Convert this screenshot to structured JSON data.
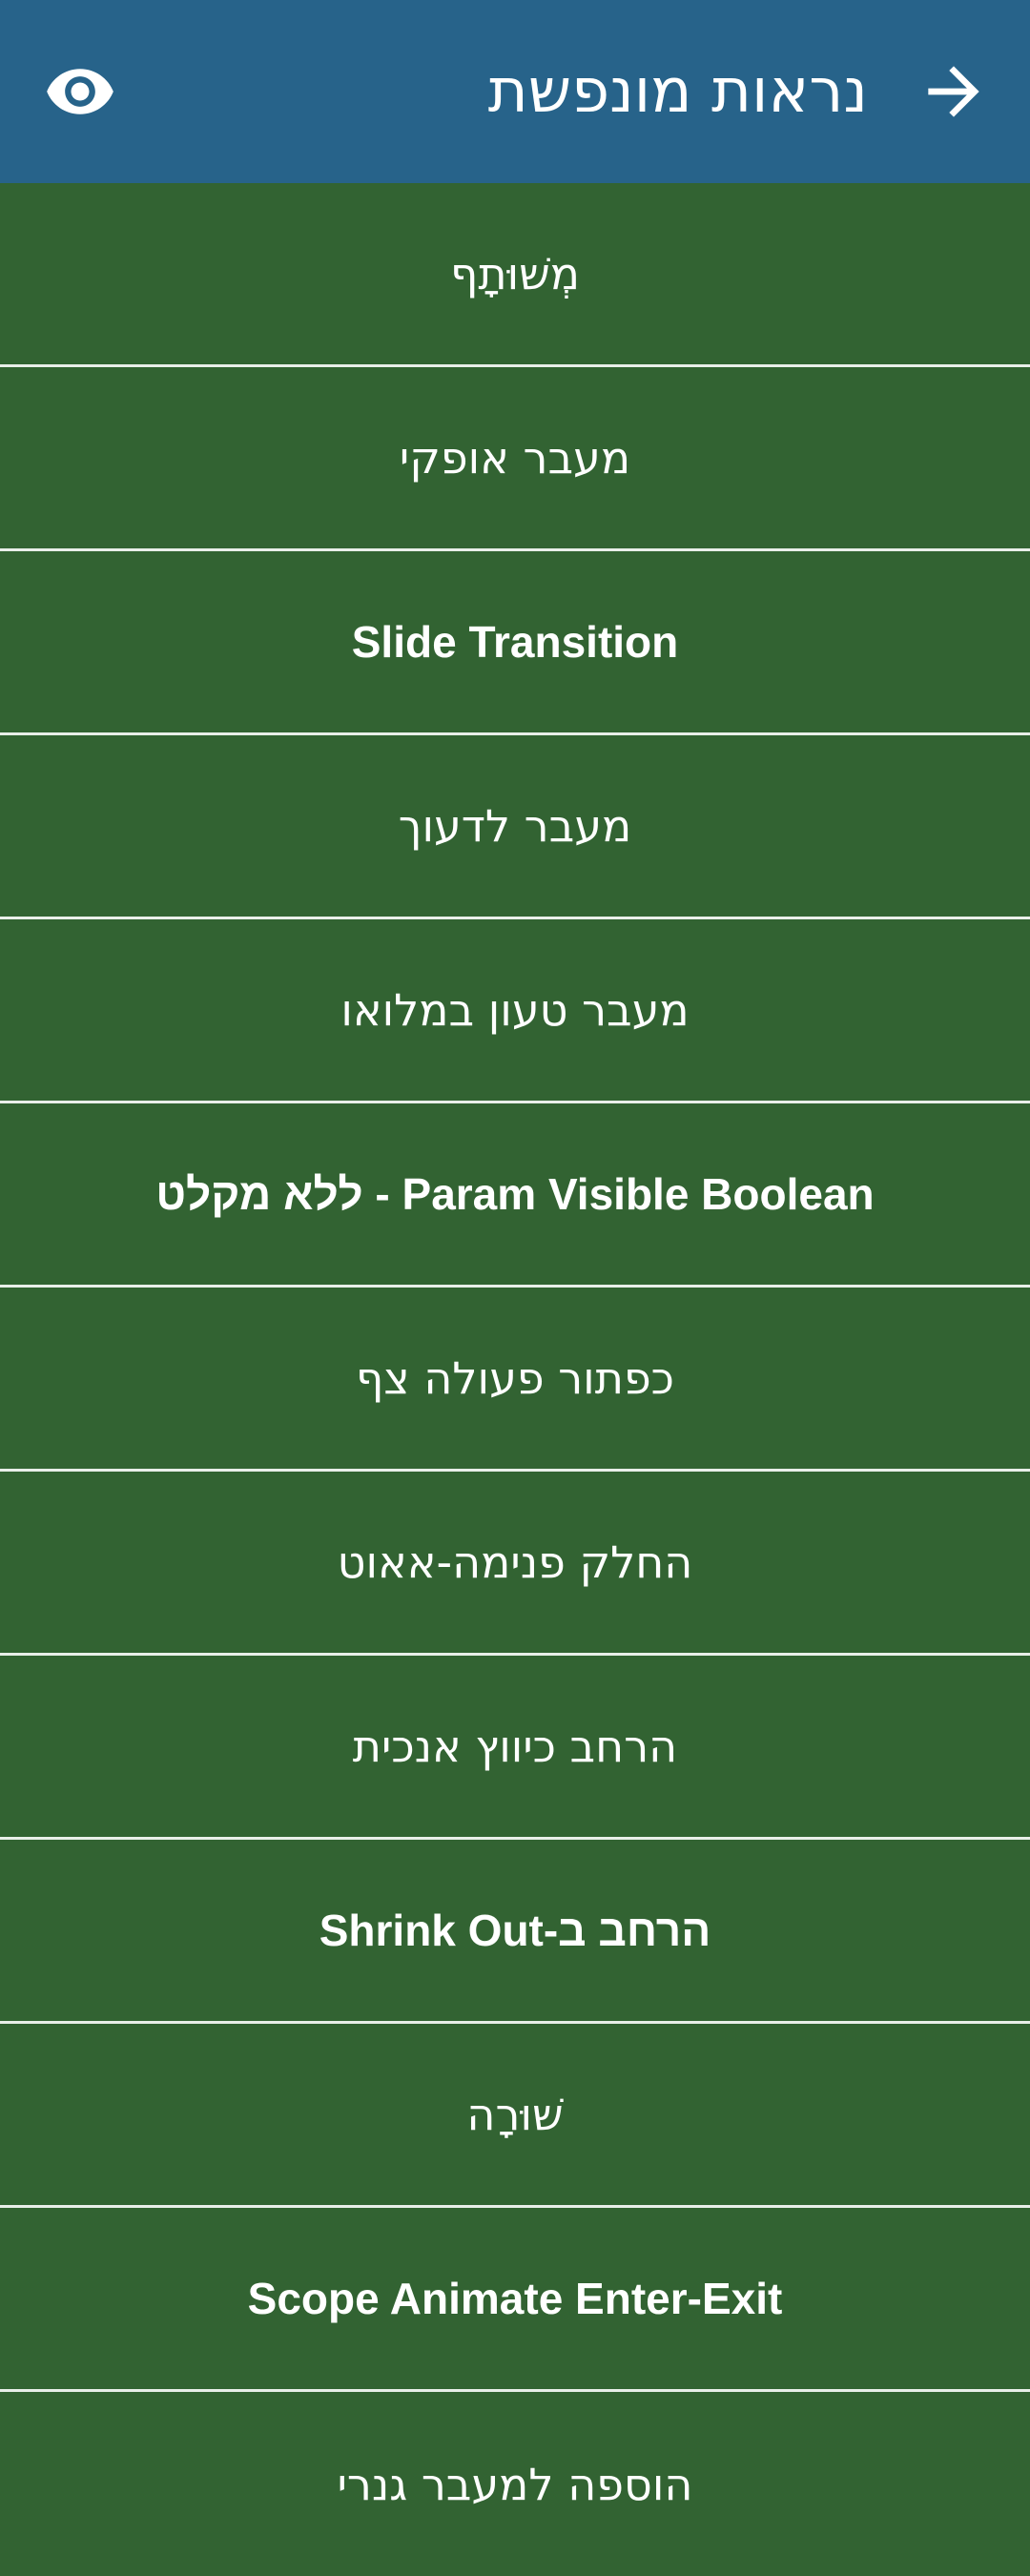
{
  "app_bar": {
    "title": "נראות מונפשת",
    "back_icon": "arrow-right-icon",
    "action_icon": "eye-icon"
  },
  "colors": {
    "app_bar": "#27638a",
    "list_background": "#326332",
    "divider": "#e9efe9",
    "text": "#ffffff"
  },
  "items": [
    {
      "label": "מְשׁוּתָף"
    },
    {
      "label": "מעבר אופקי"
    },
    {
      "label": "Slide Transition"
    },
    {
      "label": "מעבר לדעוך"
    },
    {
      "label": "מעבר טעון במלואו"
    },
    {
      "label": "Param Visible Boolean - ללא מקלט"
    },
    {
      "label": "כפתור פעולה צף"
    },
    {
      "label": "החלק פנימה-אאוט"
    },
    {
      "label": "הרחב כיווץ אנכית"
    },
    {
      "label": "הרחב ב-Shrink Out"
    },
    {
      "label": "שׁוּרָה"
    },
    {
      "label": "Scope Animate Enter-Exit"
    },
    {
      "label": "הוספה למעבר גנרי"
    }
  ]
}
